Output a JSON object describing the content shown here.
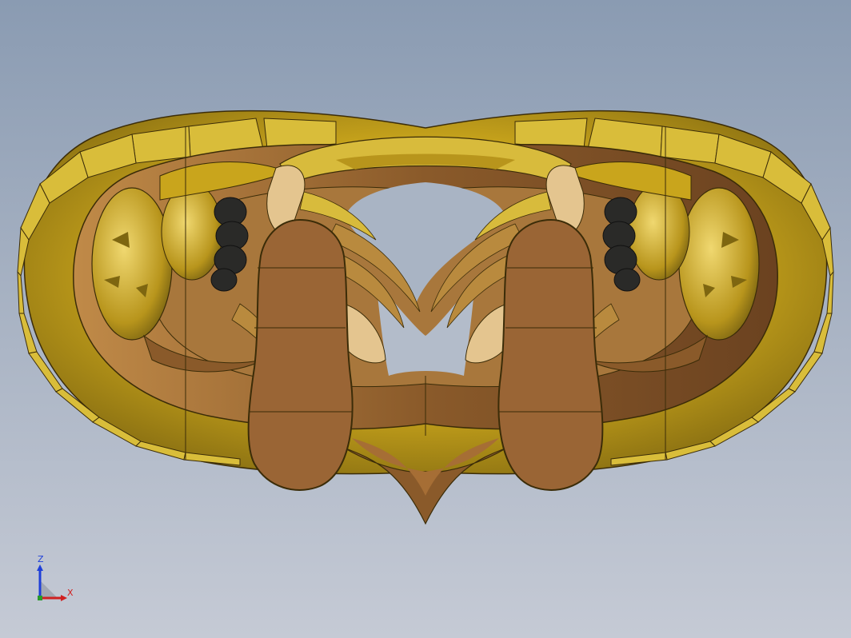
{
  "viewport": {
    "background_top": "#8a9bb2",
    "background_bottom": "#c5cad5"
  },
  "model": {
    "colors": {
      "gold": "#c9a51c",
      "gold_light": "#e6cd52",
      "gold_dark": "#7e6610",
      "bronze": "#8a5a2a",
      "bronze_light": "#b07a42",
      "sole": "#9a6535",
      "cream": "#e4c58f",
      "dark": "#2a2a28",
      "outline": "#3b2c08"
    }
  },
  "triad": {
    "axes": [
      {
        "name": "Z",
        "color": "#1f3fd8"
      },
      {
        "name": "X",
        "color": "#d02020"
      }
    ]
  }
}
